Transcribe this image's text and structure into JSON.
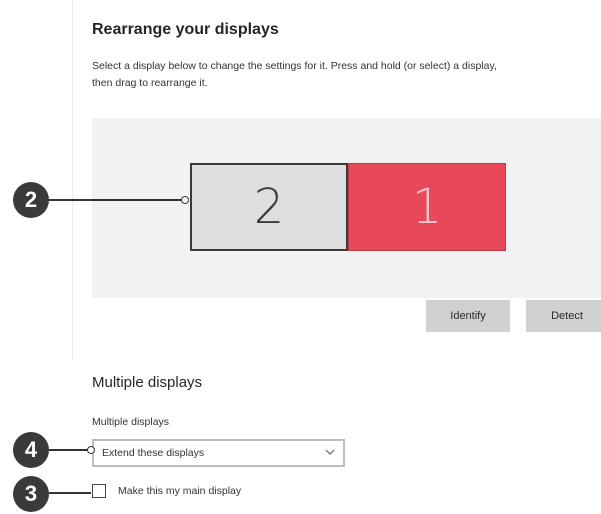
{
  "rearrange": {
    "title": "Rearrange your displays",
    "description_line1": "Select a display below to change the settings for it. Press and hold (or select) a display,",
    "description_line2": "then drag to rearrange it.",
    "monitors": [
      {
        "number": "2",
        "selected": true
      },
      {
        "number": "1",
        "selected": false
      }
    ],
    "identify_label": "Identify",
    "detect_label": "Detect"
  },
  "multiple": {
    "title": "Multiple displays",
    "field_label": "Multiple displays",
    "selected_option": "Extend these displays",
    "main_display_label": "Make this my main display",
    "main_display_checked": false
  },
  "callouts": [
    "2",
    "4",
    "3"
  ],
  "colors": {
    "primary_monitor": "#e8495a",
    "secondary_monitor": "#dedede",
    "badge": "#3a3a3a"
  },
  "icons": {
    "dropdown": "chevron-down-icon"
  }
}
